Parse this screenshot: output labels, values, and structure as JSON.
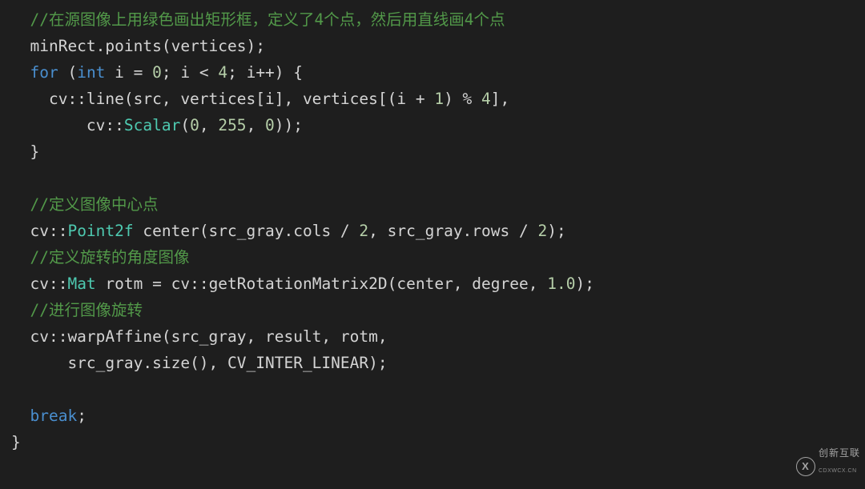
{
  "code": {
    "l1_comment": "//在源图像上用绿色画出矩形框，定义了4个点，然后用直线画4个点",
    "l2_plain": "minRect.points(vertices);",
    "l3_for": "for",
    "l3_int": "int",
    "l3_rest_a": " i = ",
    "l3_zero": "0",
    "l3_rest_b": "; i < ",
    "l3_four": "4",
    "l3_rest_c": "; i++) {",
    "l4_a": "    cv::line(src, vertices[i], vertices[(i + ",
    "l4_one": "1",
    "l4_b": ") % ",
    "l4_four": "4",
    "l4_c": "],",
    "l5_a": "        cv::",
    "l5_scalar": "Scalar",
    "l5_b": "(",
    "l5_n0": "0",
    "l5_c": ", ",
    "l5_n255": "255",
    "l5_d": ", ",
    "l5_n0b": "0",
    "l5_e": "));",
    "l6_brace": "}",
    "l8_comment": "//定义图像中心点",
    "l9_a": "cv::",
    "l9_point2f": "Point2f",
    "l9_b": " center(src_gray.cols / ",
    "l9_two": "2",
    "l9_c": ", src_gray.rows / ",
    "l9_two_b": "2",
    "l9_d": ");",
    "l10_comment": "//定义旋转的角度图像",
    "l11_a": "cv::",
    "l11_mat": "Mat",
    "l11_b": " rotm = cv::getRotationMatrix2D(center, degree, ",
    "l11_one": "1.0",
    "l11_c": ");",
    "l12_comment": "//进行图像旋转",
    "l13_plain": "cv::warpAffine(src_gray, result, rotm,",
    "l14_plain": "    src_gray.size(), CV_INTER_LINEAR);",
    "l16_break": "break",
    "l16_semi": ";",
    "l17_brace": "}"
  },
  "watermark": {
    "logo_letter": "X",
    "brand": "创新互联",
    "sub": "CDXWCX.CN"
  }
}
